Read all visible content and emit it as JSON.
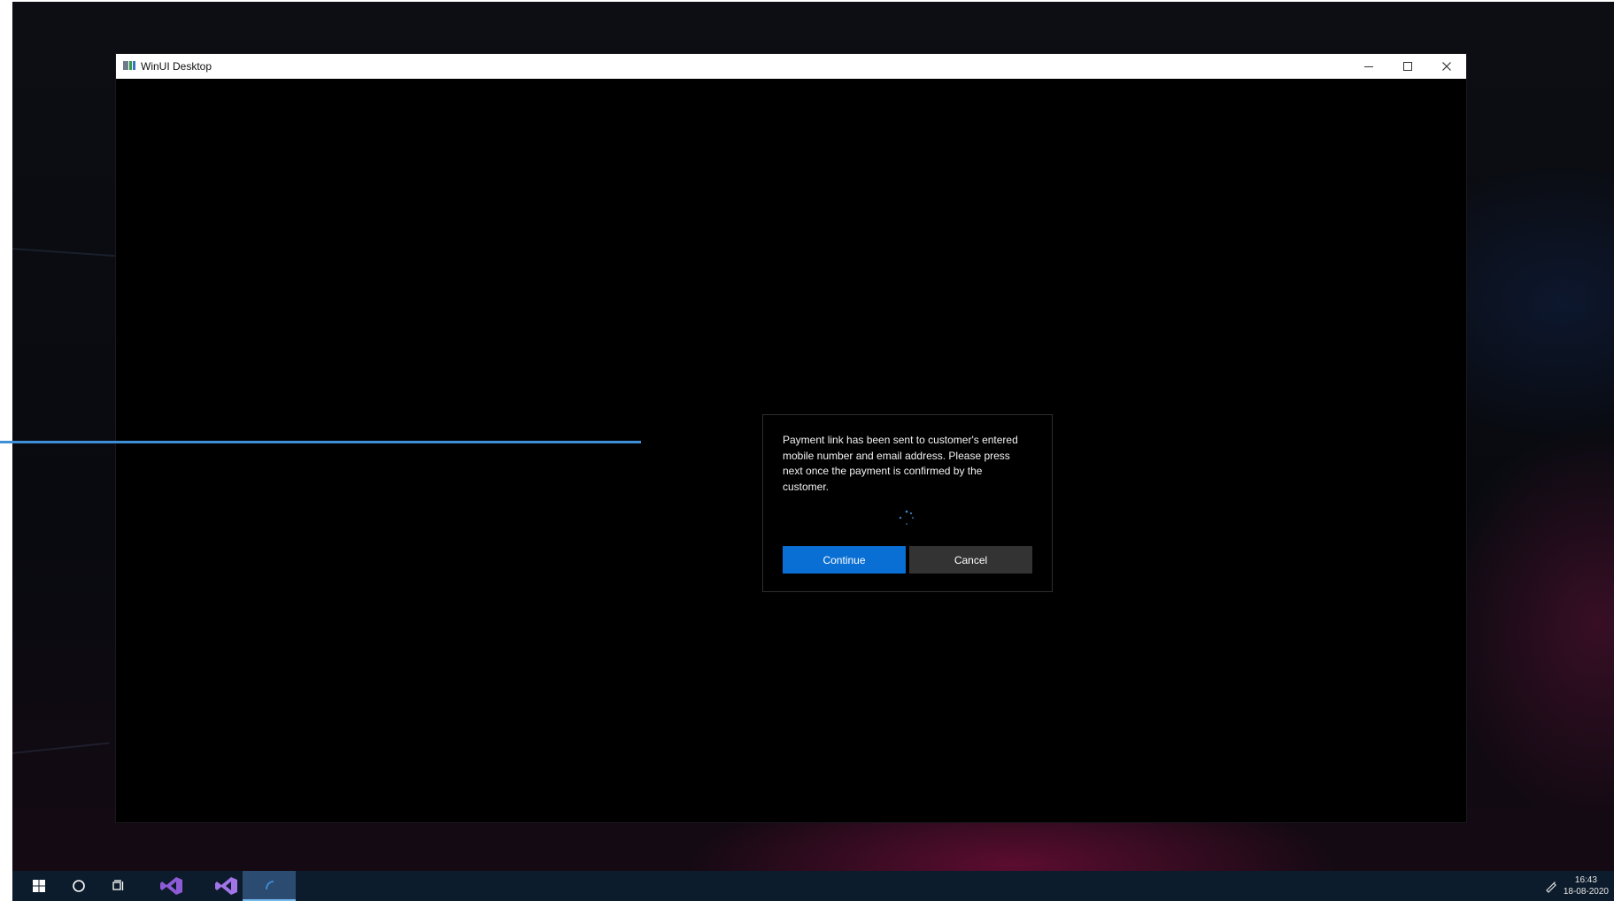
{
  "window": {
    "title": "WinUI Desktop",
    "icon": "app-window-icon",
    "controls": [
      "minimize-icon",
      "maximize-icon",
      "close-icon"
    ]
  },
  "dialog": {
    "message": "Payment link has been sent to customer's entered mobile number and email address. Please press next once the payment is confirmed by the customer.",
    "continue_label": "Continue",
    "cancel_label": "Cancel",
    "busy_indicator": "loading-spinner-icon"
  },
  "taskbar": {
    "items": [
      "windows-start-icon",
      "search-circle-icon",
      "task-view-icon",
      "visual-studio-icon",
      "visual-studio-preview-icon",
      "active-app-icon"
    ],
    "tray_icon": "pen-workspace-icon",
    "time": "16:43",
    "date": "18-08-2020"
  },
  "colors": {
    "accent": "#0a6fd4",
    "progress_line": "#3f8fd8",
    "taskbar": "#0d1c2c",
    "visual_studio": "#8e5bd6"
  }
}
